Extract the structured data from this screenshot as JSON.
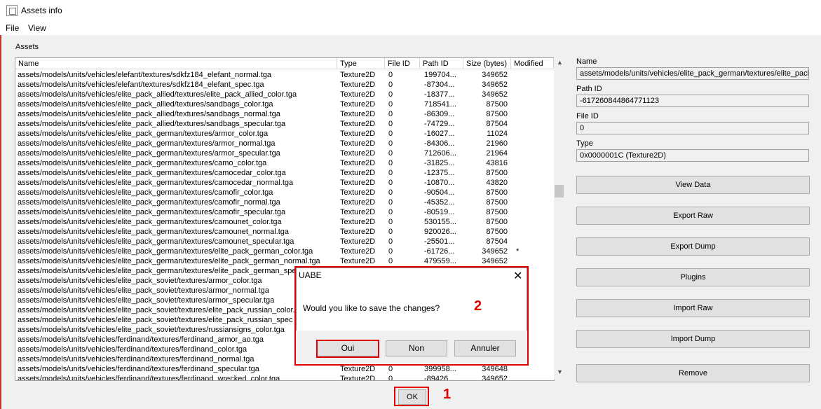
{
  "window": {
    "title": "Assets info"
  },
  "menu": {
    "file": "File",
    "view": "View"
  },
  "assets": {
    "label": "Assets",
    "columns": [
      "Name",
      "Type",
      "File ID",
      "Path ID",
      "Size (bytes)",
      "Modified"
    ],
    "rows": [
      [
        "assets/models/units/vehicles/elefant/textures/sdkfz184_elefant_normal.tga",
        "Texture2D",
        "0",
        "199704...",
        "349652",
        ""
      ],
      [
        "assets/models/units/vehicles/elefant/textures/sdkfz184_elefant_spec.tga",
        "Texture2D",
        "0",
        "-87304...",
        "349652",
        ""
      ],
      [
        "assets/models/units/vehicles/elite_pack_allied/textures/elite_pack_allied_color.tga",
        "Texture2D",
        "0",
        "-18377...",
        "349652",
        ""
      ],
      [
        "assets/models/units/vehicles/elite_pack_allied/textures/sandbags_color.tga",
        "Texture2D",
        "0",
        "718541...",
        "87500",
        ""
      ],
      [
        "assets/models/units/vehicles/elite_pack_allied/textures/sandbags_normal.tga",
        "Texture2D",
        "0",
        "-86309...",
        "87500",
        ""
      ],
      [
        "assets/models/units/vehicles/elite_pack_allied/textures/sandbags_specular.tga",
        "Texture2D",
        "0",
        "-74729...",
        "87504",
        ""
      ],
      [
        "assets/models/units/vehicles/elite_pack_german/textures/armor_color.tga",
        "Texture2D",
        "0",
        "-16027...",
        "11024",
        ""
      ],
      [
        "assets/models/units/vehicles/elite_pack_german/textures/armor_normal.tga",
        "Texture2D",
        "0",
        "-84306...",
        "21960",
        ""
      ],
      [
        "assets/models/units/vehicles/elite_pack_german/textures/armor_specular.tga",
        "Texture2D",
        "0",
        "712606...",
        "21964",
        ""
      ],
      [
        "assets/models/units/vehicles/elite_pack_german/textures/camo_color.tga",
        "Texture2D",
        "0",
        "-31825...",
        "43816",
        ""
      ],
      [
        "assets/models/units/vehicles/elite_pack_german/textures/camocedar_color.tga",
        "Texture2D",
        "0",
        "-12375...",
        "87500",
        ""
      ],
      [
        "assets/models/units/vehicles/elite_pack_german/textures/camocedar_normal.tga",
        "Texture2D",
        "0",
        "-10870...",
        "43820",
        ""
      ],
      [
        "assets/models/units/vehicles/elite_pack_german/textures/camofir_color.tga",
        "Texture2D",
        "0",
        "-90504...",
        "87500",
        ""
      ],
      [
        "assets/models/units/vehicles/elite_pack_german/textures/camofir_normal.tga",
        "Texture2D",
        "0",
        "-45352...",
        "87500",
        ""
      ],
      [
        "assets/models/units/vehicles/elite_pack_german/textures/camofir_specular.tga",
        "Texture2D",
        "0",
        "-80519...",
        "87500",
        ""
      ],
      [
        "assets/models/units/vehicles/elite_pack_german/textures/camounet_color.tga",
        "Texture2D",
        "0",
        "530155...",
        "87500",
        ""
      ],
      [
        "assets/models/units/vehicles/elite_pack_german/textures/camounet_normal.tga",
        "Texture2D",
        "0",
        "920026...",
        "87500",
        ""
      ],
      [
        "assets/models/units/vehicles/elite_pack_german/textures/camounet_specular.tga",
        "Texture2D",
        "0",
        "-25501...",
        "87504",
        ""
      ],
      [
        "assets/models/units/vehicles/elite_pack_german/textures/elite_pack_german_color.tga",
        "Texture2D",
        "0",
        "-61726...",
        "349652",
        "*"
      ],
      [
        "assets/models/units/vehicles/elite_pack_german/textures/elite_pack_german_normal.tga",
        "Texture2D",
        "0",
        "479559...",
        "349652",
        ""
      ],
      [
        "assets/models/units/vehicles/elite_pack_german/textures/elite_pack_german_spec",
        "",
        "",
        "",
        "",
        ""
      ],
      [
        "assets/models/units/vehicles/elite_pack_soviet/textures/armor_color.tga",
        "",
        "",
        "",
        "",
        ""
      ],
      [
        "assets/models/units/vehicles/elite_pack_soviet/textures/armor_normal.tga",
        "",
        "",
        "",
        "",
        ""
      ],
      [
        "assets/models/units/vehicles/elite_pack_soviet/textures/armor_specular.tga",
        "",
        "",
        "",
        "",
        ""
      ],
      [
        "assets/models/units/vehicles/elite_pack_soviet/textures/elite_pack_russian_color.",
        "",
        "",
        "",
        "",
        ""
      ],
      [
        "assets/models/units/vehicles/elite_pack_soviet/textures/elite_pack_russian_spec",
        "",
        "",
        "",
        "",
        ""
      ],
      [
        "assets/models/units/vehicles/elite_pack_soviet/textures/russiansigns_color.tga",
        "",
        "",
        "",
        "",
        ""
      ],
      [
        "assets/models/units/vehicles/ferdinand/textures/ferdinand_armor_ao.tga",
        "",
        "",
        "",
        "",
        ""
      ],
      [
        "assets/models/units/vehicles/ferdinand/textures/ferdinand_color.tga",
        "",
        "",
        "",
        "",
        ""
      ],
      [
        "assets/models/units/vehicles/ferdinand/textures/ferdinand_normal.tga",
        "",
        "",
        "",
        "",
        ""
      ],
      [
        "assets/models/units/vehicles/ferdinand/textures/ferdinand_specular.tga",
        "Texture2D",
        "0",
        "399958...",
        "349648",
        ""
      ],
      [
        "assets/models/units/vehicles/ferdinand/textures/ferdinand_wrecked_color.tga",
        "Texture2D",
        "0",
        "-89426...",
        "349652",
        ""
      ]
    ]
  },
  "details": {
    "name_label": "Name",
    "name_value": "assets/models/units/vehicles/elite_pack_german/textures/elite_pack",
    "pathid_label": "Path ID",
    "pathid_value": "-617260844864771123",
    "fileid_label": "File ID",
    "fileid_value": "0",
    "type_label": "Type",
    "type_value": "0x0000001C (Texture2D)"
  },
  "buttons": {
    "view_data": "View Data",
    "export_raw": "Export Raw",
    "export_dump": "Export Dump",
    "plugins": "Plugins",
    "import_raw": "Import Raw",
    "import_dump": "Import Dump",
    "remove": "Remove",
    "ok": "OK"
  },
  "annotations": {
    "step1": "1",
    "step2": "2",
    "color": "#e00000"
  },
  "dialog": {
    "title": "UABE",
    "message": "Would you like to save the changes?",
    "yes": "Oui",
    "no": "Non",
    "cancel": "Annuler"
  }
}
